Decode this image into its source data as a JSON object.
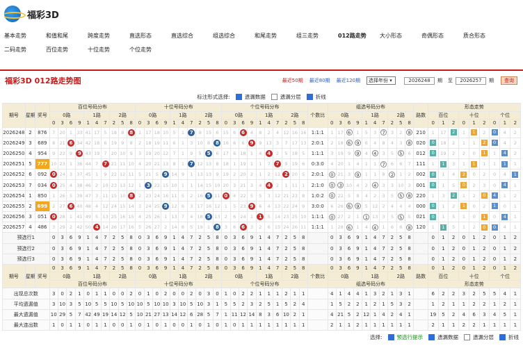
{
  "app": {
    "title": "福彩3D"
  },
  "nav": [
    "基本走势",
    "和值和尾",
    "跨度走势",
    "直选形态",
    "直选综合",
    "组选综合",
    "和尾走势",
    "组三走势",
    "012路走势",
    "大小形态",
    "奇偶形态",
    "质合形态",
    "二码走势",
    "百位走势",
    "十位走势",
    "个位走势"
  ],
  "nav_active": "012路走势",
  "panel": {
    "title": "福彩3D 012路走势图",
    "recent": [
      "最近50期",
      "最近80期",
      "最近120期"
    ],
    "select": "选择年份",
    "from": "2026248",
    "to_label": "至",
    "to": "2026257",
    "unit": "期",
    "query": "查询"
  },
  "options": {
    "label": "标注形式选择:",
    "items": [
      "遗漏数据",
      "遗漏分层",
      "折线"
    ]
  },
  "header": {
    "issue": "期号",
    "week": "星期",
    "prize": "奖号",
    "bai": "百位号码分布",
    "shi": "十位号码分布",
    "ge": "个位号码分布",
    "gs": "个数比",
    "zx": "组选号码分布",
    "lushu": "路数",
    "xt": "形态走势",
    "r0": "0路",
    "r1": "1路",
    "r2": "2路",
    "baiw": "百位",
    "shiw": "十位",
    "gew": "个位"
  },
  "digits": [
    "0",
    "3",
    "6",
    "9",
    "1",
    "4",
    "7",
    "2",
    "5",
    "8"
  ],
  "rows": [
    {
      "issue": "2026248",
      "wk": "2",
      "pz": "876",
      "bai": [
        "7",
        "20",
        "1",
        "33",
        "41",
        "17",
        "5",
        "18",
        "8",
        "8"
      ],
      "shi": [
        "1",
        "17",
        "18",
        "10",
        "5",
        "1",
        "7",
        "9",
        "15",
        "6"
      ],
      "ge": [
        "15",
        "6",
        "6",
        "4",
        "8",
        "2",
        "4",
        "12",
        "16",
        "16"
      ],
      "gs": "1:1:1",
      "zx": [
        "1",
        "17",
        "8",
        "1",
        "5",
        "3",
        "7",
        "3",
        "2",
        "8"
      ],
      "ls": "210",
      "xt": [
        "1",
        "17",
        "2",
        "1",
        "1",
        "2",
        "0",
        "4",
        "2"
      ]
    },
    {
      "issue": "2026249",
      "wk": "3",
      "pz": "689",
      "bai": [
        "8",
        "21",
        "6",
        "34",
        "42",
        "18",
        "6",
        "19",
        "9",
        "8"
      ],
      "shi": [
        "2",
        "18",
        "19",
        "11",
        "6",
        "1",
        "3",
        "10",
        "8",
        "16"
      ],
      "ge": [
        "16",
        "6",
        "6",
        "9",
        "9",
        "13",
        "3",
        "7",
        "17",
        "13"
      ],
      "gs": "2:0:1",
      "zx": [
        "2",
        "18",
        "6",
        "2",
        "6",
        "4",
        "8",
        "4",
        "3",
        "8"
      ],
      "ls": "020",
      "xt": [
        "0",
        "18",
        "2",
        "1",
        "1",
        "2",
        "0",
        "4",
        "2"
      ]
    },
    {
      "issue": "2026250",
      "wk": "4",
      "pz": "954",
      "bai": [
        "9",
        "22",
        "9",
        "35",
        "43",
        "19",
        "7",
        "20",
        "10",
        "9"
      ],
      "shi": [
        "3",
        "19",
        "20",
        "12",
        "7",
        "1",
        "9",
        "5",
        "11",
        "6"
      ],
      "ge": [
        "17",
        "6",
        "18",
        "1",
        "4",
        "1",
        "2",
        "5",
        "18",
        "5"
      ],
      "gs": "1:1:1",
      "zx": [
        "3",
        "19",
        "9",
        "3",
        "4",
        "5",
        "3",
        "5",
        "5",
        "6"
      ],
      "ls": "012",
      "xt": [
        "0",
        "19",
        "2",
        "2",
        "0",
        "1",
        "1",
        "4",
        "2"
      ]
    },
    {
      "issue": "2026251",
      "wk": "5",
      "pz": "777",
      "bai": [
        "10",
        "23",
        "1",
        "36",
        "44",
        "7",
        "8",
        "21",
        "11",
        "10"
      ],
      "shi": [
        "4",
        "20",
        "21",
        "13",
        "8",
        "1",
        "7",
        "12",
        "13",
        "8"
      ],
      "ge": [
        "18",
        "1",
        "19",
        "1",
        "1",
        "7",
        "1",
        "9",
        "19",
        "6"
      ],
      "gs": "0:3:0",
      "zx": [
        "4",
        "20",
        "1",
        "4",
        "1",
        "1",
        "7",
        "6",
        "6",
        "7"
      ],
      "ls": "111",
      "xt": [
        "1",
        "1",
        "3",
        "1",
        "1",
        "1",
        "1",
        "1",
        "1"
      ]
    },
    {
      "issue": "2026252",
      "wk": "6",
      "pz": "092",
      "bai": [
        "0",
        "24",
        "3",
        "37",
        "45",
        "1",
        "9",
        "22",
        "12",
        "11"
      ],
      "shi": [
        "5",
        "21",
        "5",
        "9",
        "14",
        "9",
        "1",
        "13",
        "13",
        "9"
      ],
      "ge": [
        "19",
        "2",
        "20",
        "2",
        "1",
        "2",
        "11",
        "2",
        "20",
        "5"
      ],
      "gs": "2:0:1",
      "zx": [
        "0",
        "21",
        "3",
        "5",
        "1",
        "1",
        "8",
        "2",
        "1",
        "2"
      ],
      "ls": "002",
      "xt": [
        "0",
        "1",
        "4",
        "2",
        "0",
        "2",
        "0",
        "4",
        "1"
      ]
    },
    {
      "issue": "2026253",
      "wk": "7",
      "pz": "034",
      "bai": [
        "0",
        "25",
        "4",
        "38",
        "46",
        "2",
        "10",
        "23",
        "13",
        "12"
      ],
      "shi": [
        "1",
        "3",
        "22",
        "15",
        "10",
        "1",
        "1",
        "14",
        "15",
        "10"
      ],
      "ge": [
        "20",
        "3",
        "21",
        "3",
        "4",
        "1",
        "2",
        "1",
        "11",
        "1"
      ],
      "gs": "2:1:0",
      "zx": [
        "0",
        "10",
        "10",
        "4",
        "2",
        "1",
        "3",
        "3",
        "10",
        "3"
      ],
      "ls": "001",
      "xt": [
        "0",
        "1",
        "5",
        "0",
        "2",
        "3",
        "0",
        "4",
        "1"
      ]
    },
    {
      "issue": "2026254",
      "wk": "1",
      "pz": "850",
      "bai": [
        "1",
        "26",
        "5",
        "39",
        "47",
        "3",
        "11",
        "15",
        "10",
        "8"
      ],
      "shi": [
        "2",
        "23",
        "24",
        "16",
        "11",
        "5",
        "2",
        "16",
        "15",
        "11"
      ],
      "ge": [
        "0",
        "4",
        "22",
        "5",
        "5",
        "3",
        "12",
        "21",
        "23",
        "8"
      ],
      "gs": "1:0:2",
      "zx": [
        "0",
        "22",
        "5",
        "8",
        "4",
        "2",
        "3",
        "5",
        "5",
        "8"
      ],
      "ls": "220",
      "xt": [
        "1",
        "3",
        "2",
        "1",
        "2",
        "0",
        "4",
        "1",
        "2"
      ]
    },
    {
      "issue": "2026255",
      "wk": "2",
      "pz": "699",
      "bai": [
        "2",
        "27",
        "6",
        "40",
        "48",
        "4",
        "12",
        "24",
        "15",
        "14"
      ],
      "shi": [
        "3",
        "24",
        "25",
        "9",
        "12",
        "6",
        "3",
        "17",
        "16",
        "12"
      ],
      "ge": [
        "1",
        "5",
        "23",
        "9",
        "6",
        "4",
        "13",
        "22",
        "24",
        "9"
      ],
      "gs": "3:0:0",
      "zx": [
        "6",
        "26",
        "6",
        "9",
        "5",
        "12",
        "2",
        "4",
        "4",
        "4"
      ],
      "ls": "000",
      "xt": [
        "0",
        "1",
        "2",
        "1",
        "0",
        "2",
        "1",
        "0",
        "1"
      ]
    },
    {
      "issue": "2026256",
      "wk": "3",
      "pz": "051",
      "bai": [
        "0",
        "28",
        "1",
        "41",
        "49",
        "5",
        "13",
        "25",
        "16",
        "15"
      ],
      "shi": [
        "4",
        "25",
        "26",
        "1",
        "13",
        "7",
        "4",
        "18",
        "5",
        "13"
      ],
      "ge": [
        "2",
        "6",
        "24",
        "1",
        "1",
        "5",
        "14",
        "23",
        "25",
        "10"
      ],
      "gs": "1:1:1",
      "zx": [
        "0",
        "27",
        "2",
        "1",
        "1",
        "13",
        "3",
        "5",
        "5",
        "5"
      ],
      "ls": "021",
      "xt": [
        "0",
        "1",
        "5",
        "1",
        "0",
        "1",
        "0",
        "4",
        "1"
      ]
    },
    {
      "issue": "2026257",
      "wk": "4",
      "pz": "486",
      "bai": [
        "3",
        "29",
        "2",
        "42",
        "50",
        "4",
        "14",
        "26",
        "17",
        "16"
      ],
      "shi": [
        "5",
        "26",
        "27",
        "2",
        "14",
        "8",
        "5",
        "19",
        "1",
        "8"
      ],
      "ge": [
        "3",
        "6",
        "25",
        "3",
        "2",
        "6",
        "15",
        "24",
        "26",
        "11"
      ],
      "gs": "1:1:1",
      "zx": [
        "1",
        "28",
        "6",
        "1",
        "4",
        "4",
        "1",
        "6",
        "6",
        "8"
      ],
      "ls": "120",
      "xt": [
        "1",
        "1",
        "5",
        "1",
        "2",
        "0",
        "0",
        "4",
        "1"
      ]
    }
  ],
  "predict": [
    "预选行1",
    "预选行2",
    "预选行3"
  ],
  "stats": [
    {
      "label": "出现总次数",
      "vals": [
        "3",
        "0",
        "2",
        "1",
        "0",
        "1",
        "1",
        "0",
        "0",
        "2",
        "0",
        "1",
        "0",
        "2",
        "0",
        "0",
        "2",
        "0",
        "3",
        "0",
        "1",
        "0",
        "2",
        "2",
        "1",
        "1",
        "1",
        "2",
        "1",
        "1",
        "4",
        "1",
        "4",
        "4",
        "1",
        "3",
        "2",
        "1",
        "3",
        "1",
        "6",
        "2",
        "2",
        "3",
        "2",
        "5",
        "5",
        "4",
        "1"
      ]
    },
    {
      "label": "平均遗漏值",
      "vals": [
        "3",
        "10",
        "3",
        "5",
        "10",
        "5",
        "5",
        "10",
        "5",
        "10",
        "10",
        "5",
        "10",
        "10",
        "3",
        "10",
        "5",
        "10",
        "3",
        "1",
        "5",
        "5",
        "2",
        "3",
        "2",
        "5",
        "1",
        "5",
        "2",
        "4",
        "1",
        "5",
        "2",
        "2",
        "1",
        "2",
        "1",
        "5",
        "3",
        "2",
        "1",
        "2",
        "1",
        "1",
        "2",
        "2",
        "1",
        "2",
        "1"
      ]
    },
    {
      "label": "最大遗漏值",
      "vals": [
        "10",
        "29",
        "5",
        "7",
        "42",
        "49",
        "19",
        "14",
        "12",
        "5",
        "10",
        "21",
        "27",
        "13",
        "14",
        "12",
        "6",
        "28",
        "5",
        "7",
        "1",
        "11",
        "12",
        "14",
        "8",
        "3",
        "6",
        "10",
        "2",
        "1",
        "4",
        "21",
        "5",
        "2",
        "12",
        "1",
        "4",
        "2",
        "4",
        "1",
        "19",
        "5",
        "2",
        "4",
        "6",
        "3",
        "4",
        "5",
        "1"
      ]
    },
    {
      "label": "最大连出数",
      "vals": [
        "1",
        "0",
        "1",
        "1",
        "0",
        "1",
        "1",
        "0",
        "0",
        "1",
        "0",
        "1",
        "0",
        "1",
        "0",
        "0",
        "1",
        "0",
        "1",
        "0",
        "1",
        "0",
        "1",
        "1",
        "1",
        "1",
        "1",
        "1",
        "1",
        "1",
        "2",
        "1",
        "1",
        "2",
        "1",
        "1",
        "1",
        "1",
        "1",
        "1",
        "2",
        "1",
        "1",
        "2",
        "2",
        "1",
        "1",
        "1",
        "1"
      ]
    }
  ],
  "footer": {
    "label": "选择:",
    "items": [
      "预选行提示",
      "遗漏数据",
      "遗漏分层",
      "折线"
    ]
  }
}
